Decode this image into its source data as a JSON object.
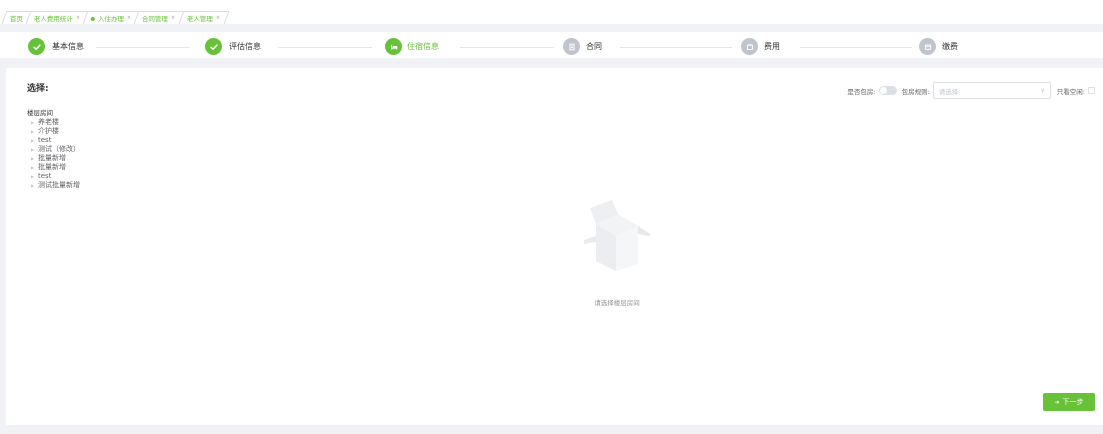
{
  "tabs": [
    {
      "label": "首页",
      "active": false,
      "closable": false
    },
    {
      "label": "老人费用统计",
      "active": false,
      "closable": true
    },
    {
      "label": "入住办理",
      "active": true,
      "closable": true
    },
    {
      "label": "合同管理",
      "active": false,
      "closable": true
    },
    {
      "label": "老人管理",
      "active": false,
      "closable": true
    }
  ],
  "close_glyph": "×",
  "steps": [
    {
      "label": "基本信息",
      "status": "done"
    },
    {
      "label": "评估信息",
      "status": "done"
    },
    {
      "label": "住宿信息",
      "status": "current"
    },
    {
      "label": "合同",
      "status": "wait"
    },
    {
      "label": "费用",
      "status": "wait"
    },
    {
      "label": "缴费",
      "status": "wait"
    }
  ],
  "main": {
    "select_title": "选择:",
    "options": {
      "package_label": "是否包房:",
      "rule_label": "包房规则:",
      "rule_placeholder": "请选择",
      "only_empty_label": "只看空闲:"
    },
    "tree": {
      "header": "楼层房间",
      "items": [
        "养老楼",
        "介护楼",
        "test",
        "测试（修改）",
        "批量新增",
        "批量新增",
        "test",
        "测试批量新增"
      ]
    },
    "empty_text": "请选择楼层房间",
    "next_button": "下一步"
  },
  "colors": {
    "accent": "#67c23a",
    "wait": "#c0c4cc",
    "background": "#f0f2f5"
  }
}
